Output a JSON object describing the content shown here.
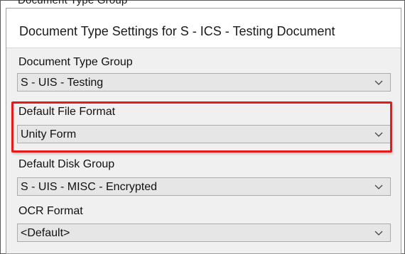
{
  "background_label": "Document Type Group",
  "dialog": {
    "title": "Document Type Settings for S - ICS - Testing Document"
  },
  "fields": [
    {
      "label": "Document Type Group",
      "value": "S - UIS - Testing"
    },
    {
      "label": "Default File Format",
      "value": "Unity Form"
    },
    {
      "label": "Default Disk Group",
      "value": "S - UIS - MISC - Encrypted"
    },
    {
      "label": "OCR Format",
      "value": "<Default>"
    }
  ],
  "colors": {
    "highlight": "#e31b1b",
    "combo_background": "#e6e6e6",
    "dialog_background": "#f0f0f0"
  },
  "icons": {
    "dropdown": "chevron-down-icon"
  }
}
